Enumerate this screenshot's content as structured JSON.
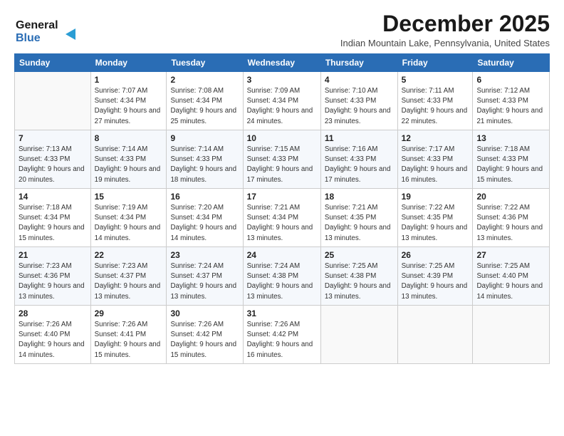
{
  "logo": {
    "line1": "General",
    "line2": "Blue"
  },
  "header": {
    "month": "December 2025",
    "location": "Indian Mountain Lake, Pennsylvania, United States"
  },
  "weekdays": [
    "Sunday",
    "Monday",
    "Tuesday",
    "Wednesday",
    "Thursday",
    "Friday",
    "Saturday"
  ],
  "weeks": [
    [
      {
        "day": "",
        "sunrise": "",
        "sunset": "",
        "daylight": ""
      },
      {
        "day": "1",
        "sunrise": "Sunrise: 7:07 AM",
        "sunset": "Sunset: 4:34 PM",
        "daylight": "Daylight: 9 hours and 27 minutes."
      },
      {
        "day": "2",
        "sunrise": "Sunrise: 7:08 AM",
        "sunset": "Sunset: 4:34 PM",
        "daylight": "Daylight: 9 hours and 25 minutes."
      },
      {
        "day": "3",
        "sunrise": "Sunrise: 7:09 AM",
        "sunset": "Sunset: 4:34 PM",
        "daylight": "Daylight: 9 hours and 24 minutes."
      },
      {
        "day": "4",
        "sunrise": "Sunrise: 7:10 AM",
        "sunset": "Sunset: 4:33 PM",
        "daylight": "Daylight: 9 hours and 23 minutes."
      },
      {
        "day": "5",
        "sunrise": "Sunrise: 7:11 AM",
        "sunset": "Sunset: 4:33 PM",
        "daylight": "Daylight: 9 hours and 22 minutes."
      },
      {
        "day": "6",
        "sunrise": "Sunrise: 7:12 AM",
        "sunset": "Sunset: 4:33 PM",
        "daylight": "Daylight: 9 hours and 21 minutes."
      }
    ],
    [
      {
        "day": "7",
        "sunrise": "Sunrise: 7:13 AM",
        "sunset": "Sunset: 4:33 PM",
        "daylight": "Daylight: 9 hours and 20 minutes."
      },
      {
        "day": "8",
        "sunrise": "Sunrise: 7:14 AM",
        "sunset": "Sunset: 4:33 PM",
        "daylight": "Daylight: 9 hours and 19 minutes."
      },
      {
        "day": "9",
        "sunrise": "Sunrise: 7:14 AM",
        "sunset": "Sunset: 4:33 PM",
        "daylight": "Daylight: 9 hours and 18 minutes."
      },
      {
        "day": "10",
        "sunrise": "Sunrise: 7:15 AM",
        "sunset": "Sunset: 4:33 PM",
        "daylight": "Daylight: 9 hours and 17 minutes."
      },
      {
        "day": "11",
        "sunrise": "Sunrise: 7:16 AM",
        "sunset": "Sunset: 4:33 PM",
        "daylight": "Daylight: 9 hours and 17 minutes."
      },
      {
        "day": "12",
        "sunrise": "Sunrise: 7:17 AM",
        "sunset": "Sunset: 4:33 PM",
        "daylight": "Daylight: 9 hours and 16 minutes."
      },
      {
        "day": "13",
        "sunrise": "Sunrise: 7:18 AM",
        "sunset": "Sunset: 4:33 PM",
        "daylight": "Daylight: 9 hours and 15 minutes."
      }
    ],
    [
      {
        "day": "14",
        "sunrise": "Sunrise: 7:18 AM",
        "sunset": "Sunset: 4:34 PM",
        "daylight": "Daylight: 9 hours and 15 minutes."
      },
      {
        "day": "15",
        "sunrise": "Sunrise: 7:19 AM",
        "sunset": "Sunset: 4:34 PM",
        "daylight": "Daylight: 9 hours and 14 minutes."
      },
      {
        "day": "16",
        "sunrise": "Sunrise: 7:20 AM",
        "sunset": "Sunset: 4:34 PM",
        "daylight": "Daylight: 9 hours and 14 minutes."
      },
      {
        "day": "17",
        "sunrise": "Sunrise: 7:21 AM",
        "sunset": "Sunset: 4:34 PM",
        "daylight": "Daylight: 9 hours and 13 minutes."
      },
      {
        "day": "18",
        "sunrise": "Sunrise: 7:21 AM",
        "sunset": "Sunset: 4:35 PM",
        "daylight": "Daylight: 9 hours and 13 minutes."
      },
      {
        "day": "19",
        "sunrise": "Sunrise: 7:22 AM",
        "sunset": "Sunset: 4:35 PM",
        "daylight": "Daylight: 9 hours and 13 minutes."
      },
      {
        "day": "20",
        "sunrise": "Sunrise: 7:22 AM",
        "sunset": "Sunset: 4:36 PM",
        "daylight": "Daylight: 9 hours and 13 minutes."
      }
    ],
    [
      {
        "day": "21",
        "sunrise": "Sunrise: 7:23 AM",
        "sunset": "Sunset: 4:36 PM",
        "daylight": "Daylight: 9 hours and 13 minutes."
      },
      {
        "day": "22",
        "sunrise": "Sunrise: 7:23 AM",
        "sunset": "Sunset: 4:37 PM",
        "daylight": "Daylight: 9 hours and 13 minutes."
      },
      {
        "day": "23",
        "sunrise": "Sunrise: 7:24 AM",
        "sunset": "Sunset: 4:37 PM",
        "daylight": "Daylight: 9 hours and 13 minutes."
      },
      {
        "day": "24",
        "sunrise": "Sunrise: 7:24 AM",
        "sunset": "Sunset: 4:38 PM",
        "daylight": "Daylight: 9 hours and 13 minutes."
      },
      {
        "day": "25",
        "sunrise": "Sunrise: 7:25 AM",
        "sunset": "Sunset: 4:38 PM",
        "daylight": "Daylight: 9 hours and 13 minutes."
      },
      {
        "day": "26",
        "sunrise": "Sunrise: 7:25 AM",
        "sunset": "Sunset: 4:39 PM",
        "daylight": "Daylight: 9 hours and 13 minutes."
      },
      {
        "day": "27",
        "sunrise": "Sunrise: 7:25 AM",
        "sunset": "Sunset: 4:40 PM",
        "daylight": "Daylight: 9 hours and 14 minutes."
      }
    ],
    [
      {
        "day": "28",
        "sunrise": "Sunrise: 7:26 AM",
        "sunset": "Sunset: 4:40 PM",
        "daylight": "Daylight: 9 hours and 14 minutes."
      },
      {
        "day": "29",
        "sunrise": "Sunrise: 7:26 AM",
        "sunset": "Sunset: 4:41 PM",
        "daylight": "Daylight: 9 hours and 15 minutes."
      },
      {
        "day": "30",
        "sunrise": "Sunrise: 7:26 AM",
        "sunset": "Sunset: 4:42 PM",
        "daylight": "Daylight: 9 hours and 15 minutes."
      },
      {
        "day": "31",
        "sunrise": "Sunrise: 7:26 AM",
        "sunset": "Sunset: 4:42 PM",
        "daylight": "Daylight: 9 hours and 16 minutes."
      },
      {
        "day": "",
        "sunrise": "",
        "sunset": "",
        "daylight": ""
      },
      {
        "day": "",
        "sunrise": "",
        "sunset": "",
        "daylight": ""
      },
      {
        "day": "",
        "sunrise": "",
        "sunset": "",
        "daylight": ""
      }
    ]
  ]
}
